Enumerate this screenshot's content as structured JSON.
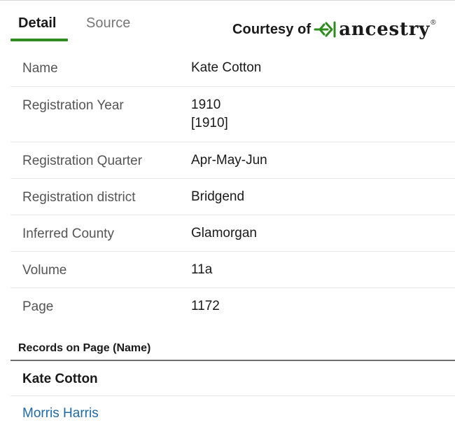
{
  "tabs": [
    {
      "label": "Detail",
      "active": true
    },
    {
      "label": "Source",
      "active": false
    }
  ],
  "branding": {
    "courtesy_text": "Courtesy of",
    "logo_word": "ancestry",
    "trademark": "®",
    "logo_color": "#2e8b1e"
  },
  "details": [
    {
      "label": "Name",
      "value": "Kate Cotton"
    },
    {
      "label": "Registration Year",
      "value": "1910",
      "value_secondary": "[1910]"
    },
    {
      "label": "Registration Quarter",
      "value": "Apr-May-Jun"
    },
    {
      "label": "Registration district",
      "value": "Bridgend"
    },
    {
      "label": "Inferred County",
      "value": "Glamorgan"
    },
    {
      "label": "Volume",
      "value": "11a"
    },
    {
      "label": "Page",
      "value": "1172"
    }
  ],
  "records": {
    "heading": "Records on Page (Name)",
    "items": [
      {
        "name": "Kate Cotton",
        "current": true
      },
      {
        "name": "Morris Harris",
        "current": false
      }
    ],
    "link_color": "#1f6aa5"
  }
}
